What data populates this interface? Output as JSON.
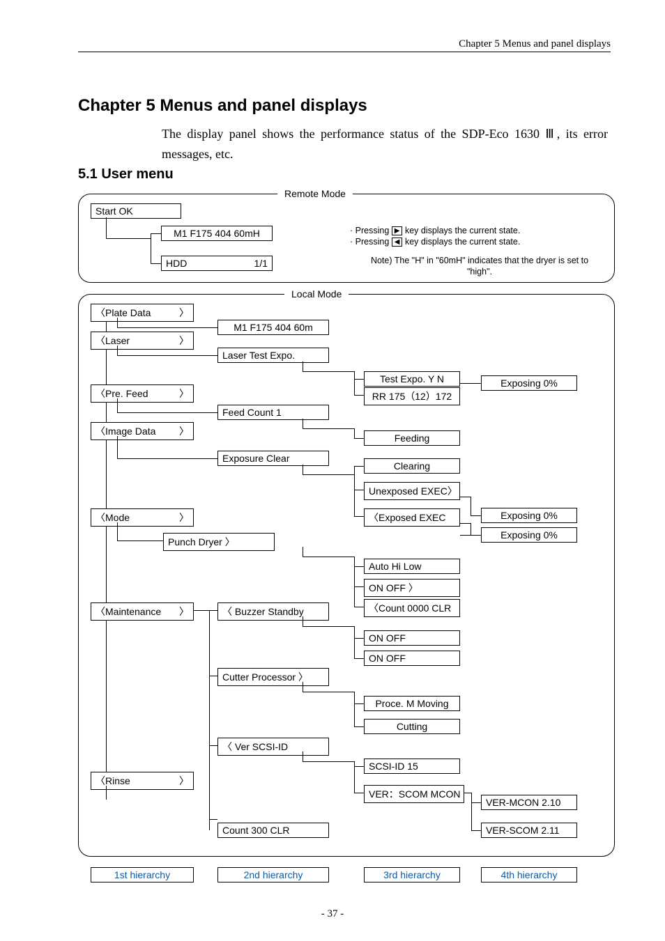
{
  "header": "Chapter 5  Menus and panel displays",
  "chapter_title": "Chapter 5 Menus and panel displays",
  "intro": "The display panel shows the performance status of the SDP-Eco 1630 Ⅲ, its error messages, etc.",
  "section_title": "5.1 User menu",
  "page_number": "- 37 -",
  "labels": {
    "remote_mode": "Remote Mode",
    "local_mode": "Local Mode"
  },
  "notes": {
    "press_right": "Pressing",
    "press_right_tail": "key displays the current state.",
    "press_left": "Pressing",
    "press_left_tail": "key displays the current state.",
    "note_h": "Note) The \"H\" in \"60mH\" indicates that the dryer is set to \"high\"."
  },
  "boxes": {
    "start_ok": "Start OK",
    "m1_remote": "M1 F175 404 60mH",
    "hdd": "HDD",
    "hdd_val": "1/1",
    "plate_data": "〈Plate Data",
    "m1_local": "M1 F175 404 60m",
    "laser": "〈Laser",
    "laser_test": "Laser    Test Expo.",
    "test_expo_yn": "Test Expo. Y N",
    "rr": "RR 175（12）172",
    "exposing0a": "Exposing 0%",
    "pre_feed": "〈Pre. Feed",
    "feed_count": "Feed Count      1",
    "image_data": "〈Image Data",
    "feeding": "Feeding",
    "exposure_clear": "Exposure     Clear",
    "clearing": "Clearing",
    "unexposed": "Unexposed EXEC〉",
    "exposed": "〈Exposed EXEC",
    "exposing0b": "Exposing 0%",
    "exposing0c": "Exposing 0%",
    "mode": "〈Mode",
    "punch_dryer": "Punch       Dryer  〉",
    "auto_hi_low": "Auto   Hi   Low",
    "on_off_arrow": "ON     OFF     〉",
    "count_clr": "〈Count 0000 CLR",
    "maintenance": "〈Maintenance",
    "buzzer_standby": "〈 Buzzer   Standby",
    "on_off1": "ON     OFF",
    "on_off2": "ON     OFF",
    "cutter_proc": "Cutter   Processor 〉",
    "proce_moving": "Proce. M Moving",
    "cutting": "Cutting",
    "ver_scsi": "〈 Ver       SCSI-ID",
    "scsi_id": "SCSI-ID    15",
    "rinse": "〈Rinse",
    "ver_scom": "VER：SCOM   MCON",
    "ver_mcon": "VER-MCON 2.10",
    "ver_scomv": "VER-SCOM 2.11",
    "count_300": "Count   300   CLR",
    "h1": "1st hierarchy",
    "h2": "2nd hierarchy",
    "h3": "3rd hierarchy",
    "h4": "4th hierarchy"
  }
}
